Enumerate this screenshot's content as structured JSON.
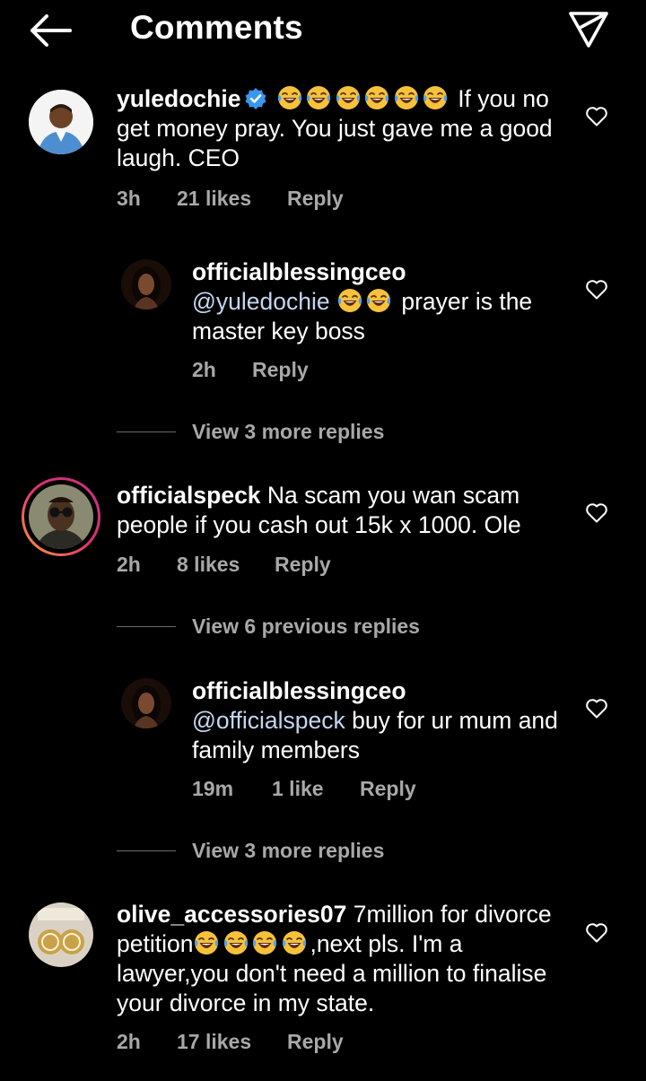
{
  "header": {
    "title": "Comments",
    "back_icon": "arrow-left-icon",
    "send_icon": "paper-plane-icon"
  },
  "colors": {
    "background": "#000000",
    "text": "#ffffff",
    "muted": "#a8a8a8",
    "mention": "#c5d6ef",
    "verified": "#3897f0",
    "story_ring": "#e1306c"
  },
  "comments": [
    {
      "username": "yuledochie",
      "verified": true,
      "emoji_count": 6,
      "text": "If you no get money pray. You just gave me a good laugh. CEO",
      "time": "3h",
      "likes": "21 likes",
      "reply": "Reply"
    },
    {
      "username": "officialblessingceo",
      "mention": "@yuledochie",
      "emoji_count": 2,
      "text": "prayer is the master key boss",
      "time": "2h",
      "reply": "Reply"
    },
    {
      "view_more": "View 3 more replies"
    },
    {
      "username": "officialspeck",
      "text": "Na scam you wan scam people if you cash out 15k x 1000. Ole",
      "time": "2h",
      "likes": "8 likes",
      "reply": "Reply"
    },
    {
      "view_previous": "View 6 previous replies"
    },
    {
      "username": "officialblessingceo",
      "mention": "@officialspeck",
      "text": "buy for ur mum and family members",
      "time": "19m",
      "likes": "1 like",
      "reply": "Reply"
    },
    {
      "view_more": "View 3 more replies"
    },
    {
      "username": "olive_accessories07",
      "text_before": "7million for divorce petition",
      "emoji_count": 4,
      "text_after": ",next pls. I'm a lawyer,you don't need a million to finalise your divorce in my state.",
      "time": "2h",
      "likes": "17 likes",
      "reply": "Reply"
    }
  ]
}
